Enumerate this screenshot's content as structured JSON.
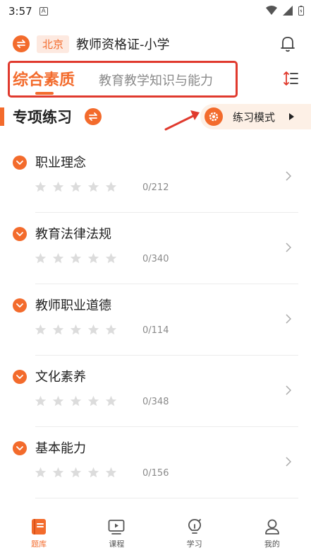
{
  "status_bar": {
    "time": "3:57",
    "notification_letter": "A"
  },
  "header": {
    "city": "北京",
    "title": "教师资格证-小学"
  },
  "tabs": [
    {
      "label": "综合素质",
      "active": true
    },
    {
      "label": "教育教学知识与能力",
      "active": false
    }
  ],
  "section": {
    "title": "专项练习",
    "mode_label": "练习模式"
  },
  "items": [
    {
      "title": "职业理念",
      "count": "0/212",
      "stars": 0
    },
    {
      "title": "教育法律法规",
      "count": "0/340",
      "stars": 0
    },
    {
      "title": "教师职业道德",
      "count": "0/114",
      "stars": 0
    },
    {
      "title": "文化素养",
      "count": "0/348",
      "stars": 0
    },
    {
      "title": "基本能力",
      "count": "0/156",
      "stars": 0
    }
  ],
  "nav": [
    {
      "label": "题库",
      "icon": "question-bank-icon",
      "active": true
    },
    {
      "label": "课程",
      "icon": "video-course-icon",
      "active": false
    },
    {
      "label": "学习",
      "icon": "lightbulb-icon",
      "active": false
    },
    {
      "label": "我的",
      "icon": "profile-icon",
      "active": false
    }
  ],
  "colors": {
    "accent": "#f36b2c",
    "annotation_red": "#e03a2e",
    "star_inactive": "#dcdcdc"
  }
}
